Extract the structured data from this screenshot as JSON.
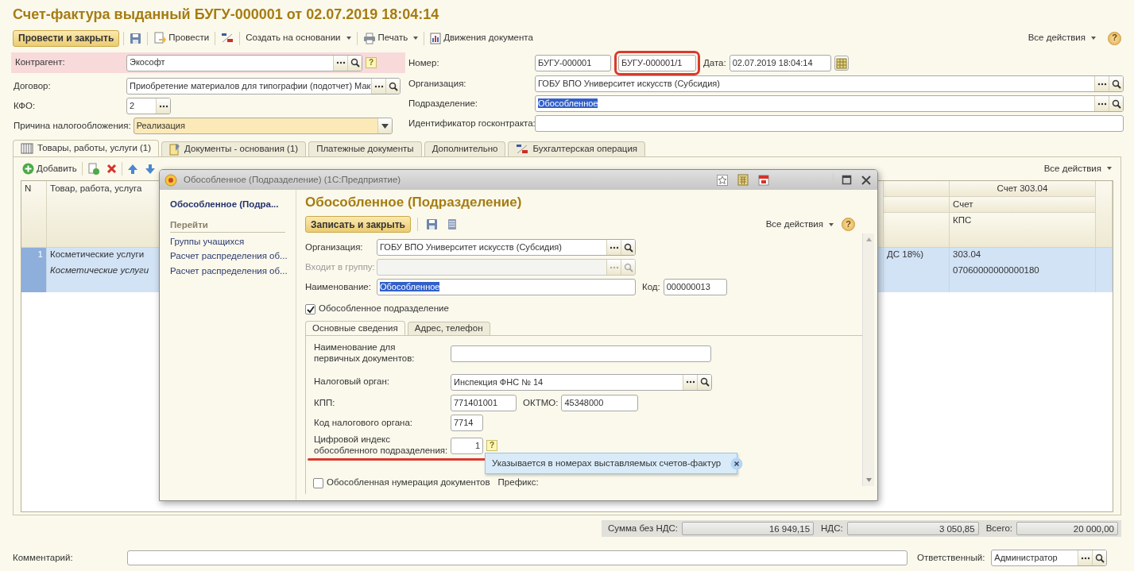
{
  "title": "Счет-фактура выданный БУГУ-000001 от 02.07.2019 18:04:14",
  "toolbar": {
    "primary": "Провести и закрыть",
    "items": [
      {
        "kind": "icon"
      },
      {
        "kind": "button",
        "label": "Провести"
      },
      {
        "kind": "icon"
      },
      {
        "kind": "menu",
        "label": "Создать на основании"
      },
      {
        "kind": "menu",
        "label": "Печать"
      },
      {
        "kind": "button",
        "label": "Движения документа"
      }
    ],
    "all_actions": "Все действия",
    "help": "?"
  },
  "left_fields": [
    {
      "label": "Контрагент:",
      "kind": "ref",
      "value": "Экософт",
      "highlight": true,
      "hint": "?"
    },
    {
      "label": "Договор:",
      "kind": "ref",
      "value": "Приобретение материалов для типографии (подотчет) Мак"
    },
    {
      "label": "КФО:",
      "kind": "choice",
      "value": "2"
    },
    {
      "label": "Причина налогообложения:",
      "kind": "select",
      "value": "Реализация"
    }
  ],
  "number": {
    "label": "Номер:",
    "prefix": "БУГУ-000001",
    "value": "БУГУ-000001/1",
    "annotated": true
  },
  "date": {
    "label": "Дата:",
    "value": "02.07.2019 18:04:14"
  },
  "right_fields": [
    {
      "label": "Организация:",
      "kind": "ref",
      "value": "ГОБУ ВПО Университет искусств (Субсидия)"
    },
    {
      "label": "Подразделение:",
      "kind": "ref",
      "value": "Обособленное",
      "text_selected": true
    },
    {
      "label": "Идентификатор госконтракта:",
      "kind": "plain"
    }
  ],
  "tabs": [
    {
      "label": "Товары, работы, услуги (1)",
      "selected": true
    },
    {
      "label": "Документы - основания (1)",
      "selected": false
    },
    {
      "label": "Платежные документы",
      "selected": false
    },
    {
      "label": "Дополнительно",
      "selected": false
    },
    {
      "label": "Бухгалтерская операция",
      "selected": false
    }
  ],
  "table_toolbar": {
    "add": "Добавить",
    "all_actions": "Все действия"
  },
  "table": {
    "columns": {
      "n": "N",
      "product": "Товар, работа, услуга",
      "account_group": "Счет 303.04",
      "account": "Счет",
      "kps": "КПС"
    },
    "rows": [
      {
        "selected": true,
        "n": "1",
        "product": "Косметические услуги",
        "product_detail": "Косметические услуги",
        "column_3": "ДС 18%)",
        "account": "303.04",
        "kps": "07060000000000180"
      }
    ]
  },
  "totals": [
    {
      "label": "Сумма без НДС:",
      "value": "16 949,15"
    },
    {
      "label": "НДС:",
      "value": "3 050,85"
    },
    {
      "label": "Всего:",
      "value": "20 000,00"
    }
  ],
  "comment": {
    "label": "Комментарий:"
  },
  "responsible": {
    "label": "Ответственный:",
    "value": "Администратор"
  },
  "dialog": {
    "title": "Обособленное (Подразделение)  (1С:Предприятие)",
    "nav_title": "Обособленное (Подра...",
    "nav_group": "Перейти",
    "nav_links": [
      "Группы учащихся",
      "Расчет распределения об...",
      "Расчет распределения об..."
    ],
    "heading": "Обособленное (Подразделение)",
    "primary": "Записать и закрыть",
    "all_actions": "Все действия",
    "help": "?",
    "fields": [
      {
        "label": "Организация:",
        "kind": "ref",
        "value": "ГОБУ ВПО Университет искусств (Субсидия)",
        "disabled": false
      },
      {
        "label": "Входит в группу:",
        "kind": "ref",
        "disabled": true
      },
      {
        "label": "Наименование:",
        "kind": "plain",
        "value": "Обособленное",
        "text_selected": true,
        "disabled": false
      }
    ],
    "code": {
      "label": "Код:",
      "value": "000000013"
    },
    "separate": {
      "label": "Обособленное подразделение",
      "checked": true
    },
    "tabs": [
      {
        "label": "Основные сведения",
        "selected": true
      },
      {
        "label": "Адрес, телефон",
        "selected": false
      }
    ],
    "primary_doc_name": {
      "label": "Наименование для первичных документов:"
    },
    "tax_office": {
      "label": "Налоговый орган:",
      "value": "Инспекция ФНС № 14"
    },
    "kpp": {
      "label": "КПП:",
      "value": "771401001"
    },
    "oktmo": {
      "label": "ОКТМО:",
      "value": "45348000"
    },
    "tax_code": {
      "label": "Код налогового органа:",
      "value": "7714"
    },
    "digit_index": {
      "label": "Цифровой индекс обособленного подразделения:",
      "value": "1",
      "hint": "?",
      "annotated": true
    },
    "tooltip": "Указывается в номерах выставляемых счетов-фактур",
    "separate_numbering": {
      "label": "Обособленная нумерация документов",
      "checked": false
    },
    "prefix": {
      "label": "Префикс:"
    }
  }
}
